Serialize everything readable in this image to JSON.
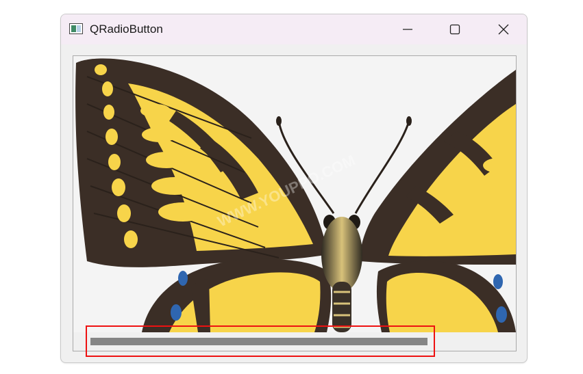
{
  "window": {
    "title": "QRadioButton",
    "controls": {
      "minimize_icon": "minimize-icon",
      "maximize_icon": "maximize-icon",
      "close_icon": "close-icon"
    }
  },
  "content": {
    "image": "butterfly",
    "watermark_text": "WWW.YOUPPO.COM"
  },
  "scrollbar": {
    "orientation": "horizontal",
    "thumb_fraction": 0.77,
    "position_fraction": 0.0
  },
  "colors": {
    "titlebar": "#f5ecf5",
    "highlight": "#ee1111",
    "thumb": "#858585",
    "wing_yellow": "#f7d44a",
    "wing_dark": "#3b2e26"
  }
}
